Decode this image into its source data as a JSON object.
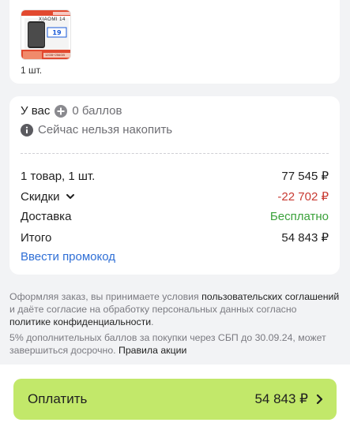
{
  "product": {
    "thumb_caption": "XIAOMI 14",
    "thumb_spec": "12GB+256GB",
    "qty": "1 шт."
  },
  "bonus": {
    "you_have": "У вас",
    "balance": "0 баллов",
    "cannot": "Сейчас нельзя накопить"
  },
  "summary": {
    "items_label": "1 товар, 1 шт.",
    "items_value": "77 545 ₽",
    "discounts_label": "Скидки",
    "discounts_value": "-22 702 ₽",
    "delivery_label": "Доставка",
    "delivery_value": "Бесплатно",
    "total_label": "Итого",
    "total_value": "54 843 ₽",
    "promo_link": "Ввести промокод"
  },
  "legal": {
    "p1_a": "Оформляя заказ, вы принимаете условия ",
    "p1_link1": "пользовательских соглашений",
    "p1_b": " и даёте согласие на обработку персональных данных согласно ",
    "p1_link2": "политике конфиденциальности",
    "p1_c": ".",
    "p2_a": "5% дополнительных баллов за покупки через СБП до 30.09.24, может завершиться досрочно. ",
    "p2_link": "Правила акции"
  },
  "pay_button": {
    "label": "Оплатить",
    "amount": "54 843 ₽"
  },
  "colors": {
    "pay_bg": "#c2e86a",
    "discount": "#c83a32",
    "free": "#3aa13a",
    "link": "#2f6fd6"
  }
}
